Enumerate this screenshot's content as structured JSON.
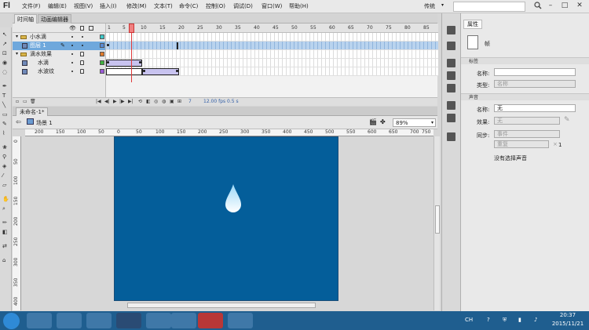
{
  "app": {
    "logo": "Fl",
    "workspace": "传统",
    "window_buttons": [
      "–",
      "□",
      "✕"
    ]
  },
  "menu": [
    "文件(F)",
    "编辑(E)",
    "视图(V)",
    "插入(I)",
    "修改(M)",
    "文本(T)",
    "命令(C)",
    "控制(O)",
    "调试(D)",
    "窗口(W)",
    "帮助(H)"
  ],
  "timeline": {
    "tabs": [
      "时间轴",
      "动画编辑器"
    ],
    "frame_numbers": [
      "1",
      "5",
      "10",
      "15",
      "20",
      "25",
      "30",
      "35",
      "40",
      "45",
      "50",
      "55",
      "60",
      "65",
      "70",
      "75",
      "80",
      "85"
    ],
    "layers": [
      {
        "name": "小水滴",
        "type": "folder",
        "color": "#3cc8c8"
      },
      {
        "name": "图层 1",
        "type": "layer",
        "color": "#5a8cd6",
        "selected": true
      },
      {
        "name": "滴水效果",
        "type": "folder",
        "color": "#e07a2a"
      },
      {
        "name": "水滴",
        "type": "layer",
        "color": "#40b040"
      },
      {
        "name": "水波纹",
        "type": "layer",
        "color": "#9a5ad6"
      }
    ],
    "current_frame": "7",
    "fps": "12.00 fps",
    "time": "0.5 s"
  },
  "document": {
    "tab": "未命名-1*",
    "scene": "场景 1",
    "zoom": "89%",
    "ruler_h": [
      "200",
      "150",
      "100",
      "50",
      "0",
      "50",
      "100",
      "150",
      "200",
      "250",
      "300",
      "350",
      "400",
      "450",
      "500",
      "550",
      "600",
      "650",
      "700",
      "750"
    ],
    "ruler_v": [
      "0",
      "50",
      "100",
      "150",
      "200",
      "250",
      "300",
      "350",
      "400"
    ],
    "stage_color": "#045e9a"
  },
  "properties": {
    "tab": "属性",
    "frame_label": "帧",
    "sections": {
      "label": "标签",
      "sound": "声音"
    },
    "name_label": "名称:",
    "name_value": "",
    "type_label": "类型:",
    "type_value": "名称",
    "sound_name_label": "名称:",
    "sound_name_value": "无",
    "effect_label": "效果:",
    "effect_value": "无",
    "sync_label": "同步:",
    "sync_value": "事件",
    "repeat_value": "重复",
    "repeat_count": "1",
    "no_sound": "没有选择声音"
  },
  "taskbar": {
    "time": "20:37",
    "date": "2015/11/21",
    "lang": "CH"
  }
}
